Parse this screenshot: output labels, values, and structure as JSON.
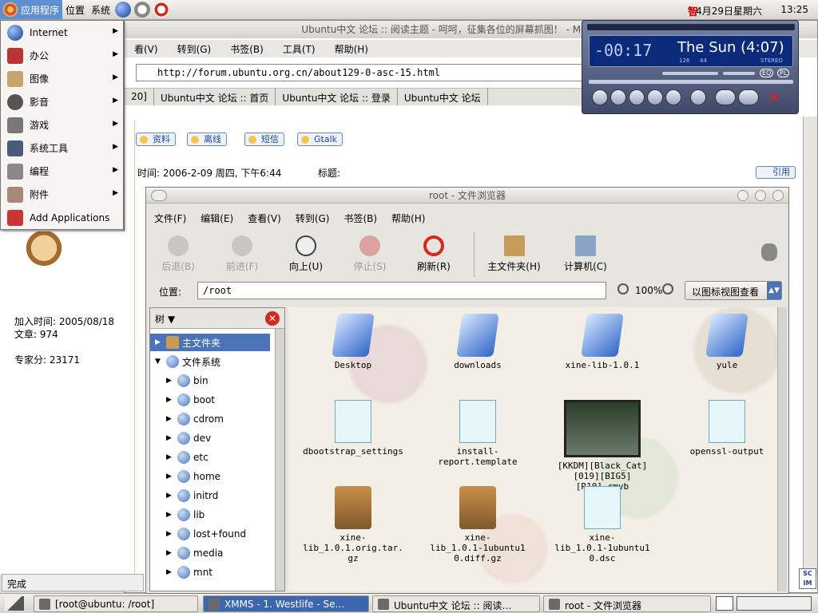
{
  "top_panel": {
    "menus": [
      "应用程序",
      "位置",
      "系统"
    ],
    "ime": "智",
    "date": "4月29日星期六",
    "time": "13:25"
  },
  "app_menu": {
    "items": [
      {
        "label": "Internet",
        "submenu": true,
        "icon": "globe-icon"
      },
      {
        "label": "办公",
        "submenu": true,
        "icon": "office-icon"
      },
      {
        "label": "图像",
        "submenu": true,
        "icon": "graphics-icon"
      },
      {
        "label": "影音",
        "submenu": true,
        "icon": "multimedia-icon"
      },
      {
        "label": "游戏",
        "submenu": true,
        "icon": "games-icon"
      },
      {
        "label": "系统工具",
        "submenu": true,
        "icon": "system-tools-icon"
      },
      {
        "label": "编程",
        "submenu": true,
        "icon": "programming-icon"
      },
      {
        "label": "附件",
        "submenu": true,
        "icon": "accessories-icon"
      },
      {
        "label": "Add Applications",
        "submenu": false,
        "icon": "add-applications-icon"
      }
    ]
  },
  "browser": {
    "title": "Ubuntu中文 论坛 :: 阅读主题 - 呵呵，征集各位的屏幕抓图！ - Mozilla Firefox",
    "menu": [
      "看(V)",
      "转到(G)",
      "书签(B)",
      "工具(T)",
      "帮助(H)"
    ],
    "url": "http://forum.ubuntu.org.cn/about129-0-asc-15.html",
    "tabs": [
      "20]",
      "Ubuntu中文 论坛 :: 首页",
      "Ubuntu中文 论坛 :: 登录",
      "Ubuntu中文 论坛"
    ],
    "status": "完成"
  },
  "forum": {
    "buttons": [
      "资料",
      "离线",
      "短信",
      "Gtalk"
    ],
    "post_time": "时间: 2006-2-09 周四, 下午6:44",
    "subject_label": "标题:",
    "quote_button": "引用",
    "user": {
      "join_time": "加入时间: 2005/08/18",
      "posts": "文章: 974",
      "score": "专家分: 23171"
    }
  },
  "nautilus": {
    "title": "root - 文件浏览器",
    "menu": [
      "文件(F)",
      "编辑(E)",
      "查看(V)",
      "转到(G)",
      "书签(B)",
      "帮助(H)"
    ],
    "toolbar": [
      {
        "label": "后退(B)",
        "disabled": true,
        "icon": "back-arrow-icon"
      },
      {
        "label": "前进(F)",
        "disabled": true,
        "icon": "forward-arrow-icon"
      },
      {
        "label": "向上(U)",
        "disabled": false,
        "icon": "up-arrow-icon"
      },
      {
        "label": "停止(S)",
        "disabled": true,
        "icon": "stop-icon"
      },
      {
        "label": "刷新(R)",
        "disabled": false,
        "icon": "refresh-icon"
      },
      {
        "label": "主文件夹(H)",
        "disabled": false,
        "icon": "home-icon"
      },
      {
        "label": "计算机(C)",
        "disabled": false,
        "icon": "computer-icon"
      }
    ],
    "location_label": "位置:",
    "location": "/root",
    "zoom": "100%",
    "view_mode": "以图标视图查看",
    "tree_label": "树",
    "tree": [
      {
        "label": "主文件夹",
        "selected": true,
        "indent": 0
      },
      {
        "label": "文件系统",
        "selected": false,
        "indent": 0,
        "expanded": true
      },
      {
        "label": "bin",
        "indent": 1
      },
      {
        "label": "boot",
        "indent": 1
      },
      {
        "label": "cdrom",
        "indent": 1
      },
      {
        "label": "dev",
        "indent": 1
      },
      {
        "label": "etc",
        "indent": 1
      },
      {
        "label": "home",
        "indent": 1
      },
      {
        "label": "initrd",
        "indent": 1
      },
      {
        "label": "lib",
        "indent": 1
      },
      {
        "label": "lost+found",
        "indent": 1
      },
      {
        "label": "media",
        "indent": 1
      },
      {
        "label": "mnt",
        "indent": 1
      }
    ],
    "files": [
      {
        "name": "Desktop",
        "kind": "folder"
      },
      {
        "name": "downloads",
        "kind": "folder"
      },
      {
        "name": "xine-lib-1.0.1",
        "kind": "folder"
      },
      {
        "name": "yule",
        "kind": "folder"
      },
      {
        "name": "dbootstrap_settings",
        "kind": "doc"
      },
      {
        "name": "install-\nreport.template",
        "kind": "doc"
      },
      {
        "name": "[KKDM][Black_Cat]\n[019][BIG5]\n[R10].rmvb",
        "kind": "video"
      },
      {
        "name": "openssl-output",
        "kind": "doc"
      },
      {
        "name": "xine-\nlib_1.0.1.orig.tar.\ngz",
        "kind": "tgz"
      },
      {
        "name": "xine-\nlib_1.0.1-1ubuntu1\n0.diff.gz",
        "kind": "gz"
      },
      {
        "name": "xine-\nlib_1.0.1-1ubuntu1\n0.dsc",
        "kind": "doc"
      }
    ]
  },
  "xmms": {
    "time": "-00:17",
    "song": "The Sun (4:07)",
    "kbps": "128",
    "khz": "44",
    "mode": "STEREO",
    "eq": "EQ",
    "pl": "PL"
  },
  "taskbar": {
    "tasks": [
      {
        "label": "[root@ubuntu: /root]",
        "active": false
      },
      {
        "label": "XMMS - 1. Westlife - Se…",
        "active": true
      },
      {
        "label": "Ubuntu中文 论坛 :: 阅读…",
        "active": false
      },
      {
        "label": "root - 文件浏览器",
        "active": false
      }
    ]
  },
  "colors": {
    "selection": "#4a73b8",
    "panel_highlight": "#5f8fd1",
    "xmms_bg": "#404a68"
  }
}
